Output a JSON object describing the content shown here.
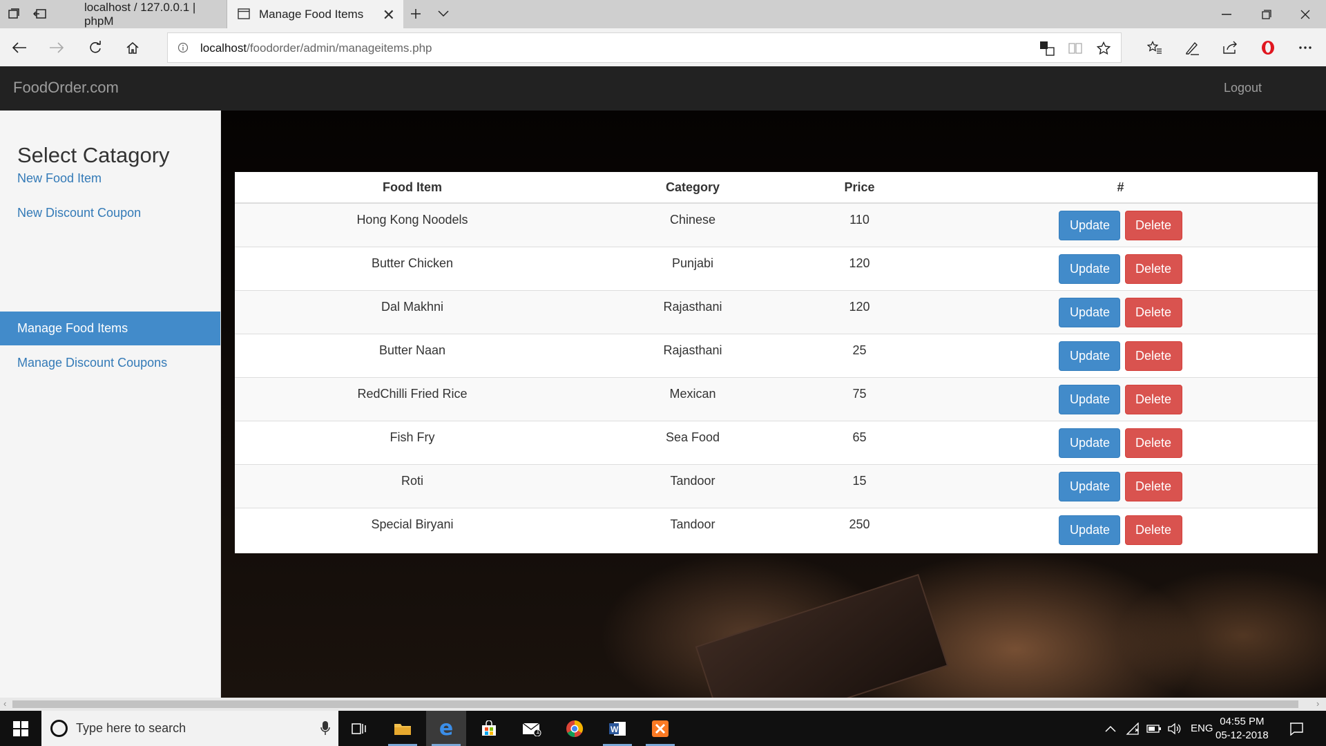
{
  "browser": {
    "tabs": [
      {
        "label": "localhost / 127.0.0.1 | phpM",
        "active": false
      },
      {
        "label": "Manage Food Items",
        "active": true
      }
    ],
    "url_host": "localhost",
    "url_path": "/foodorder/admin/manageitems.php"
  },
  "navbar": {
    "brand": "FoodOrder.com",
    "logout": "Logout"
  },
  "sidebar": {
    "title": "Select Catagory",
    "items": [
      {
        "label": "New Food Item",
        "active": false
      },
      {
        "label": "New Discount Coupon",
        "active": false
      },
      {
        "label": "Manage Food Items",
        "active": true
      },
      {
        "label": "Manage Discount Coupons",
        "active": false
      }
    ]
  },
  "table": {
    "headers": [
      "Food Item",
      "Category",
      "Price",
      "#"
    ],
    "update_label": "Update",
    "delete_label": "Delete",
    "rows": [
      {
        "item": "Hong Kong Noodels",
        "category": "Chinese",
        "price": "110"
      },
      {
        "item": "Butter Chicken",
        "category": "Punjabi",
        "price": "120"
      },
      {
        "item": "Dal Makhni",
        "category": "Rajasthani",
        "price": "120"
      },
      {
        "item": "Butter Naan",
        "category": "Rajasthani",
        "price": "25"
      },
      {
        "item": "RedChilli Fried Rice",
        "category": "Mexican",
        "price": "75"
      },
      {
        "item": "Fish Fry",
        "category": "Sea Food",
        "price": "65"
      },
      {
        "item": "Roti",
        "category": "Tandoor",
        "price": "15"
      },
      {
        "item": "Special Biryani",
        "category": "Tandoor",
        "price": "250"
      }
    ]
  },
  "taskbar": {
    "search_placeholder": "Type here to search",
    "mail_badge": "1",
    "language": "ENG",
    "time": "04:55 PM",
    "date": "05-12-2018"
  },
  "colors": {
    "navbar": "#222222",
    "sidebar_active": "#428bca",
    "link": "#337ab7",
    "update_button": "#428bca",
    "delete_button": "#d9534f"
  }
}
